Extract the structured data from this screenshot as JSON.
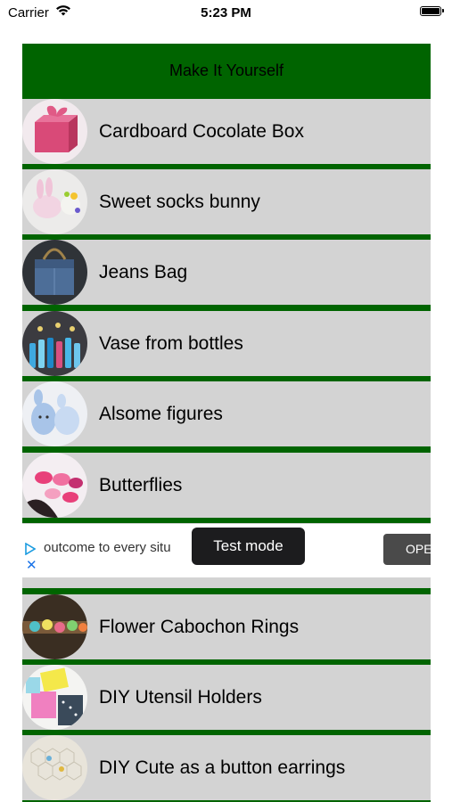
{
  "status_bar": {
    "carrier": "Carrier",
    "time": "5:23 PM"
  },
  "header": {
    "title": "Make It Yourself"
  },
  "list": {
    "items": [
      {
        "label": "Cardboard Cocolate Box"
      },
      {
        "label": "Sweet socks bunny"
      },
      {
        "label": "Jeans Bag"
      },
      {
        "label": "Vase from bottles"
      },
      {
        "label": "Alsome figures"
      },
      {
        "label": "Butterflies"
      },
      {
        "label": "Flower Cabochon Rings"
      },
      {
        "label": "DIY Utensil Holders"
      },
      {
        "label": "DIY Cute as a button earrings"
      }
    ]
  },
  "ad": {
    "text": "outcome to every situ",
    "button_label": "OPEN"
  },
  "toast": {
    "text": "Test mode"
  },
  "colors": {
    "header_bg": "#006400",
    "row_bg": "#d3d3d3",
    "separator": "#006400"
  }
}
